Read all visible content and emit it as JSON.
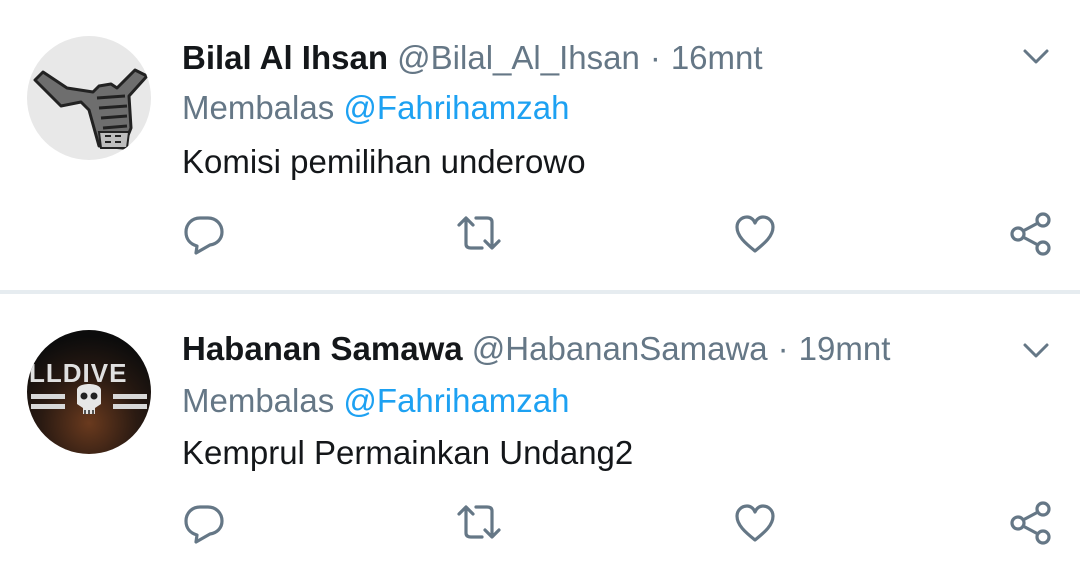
{
  "tweets": [
    {
      "display_name": "Bilal Al Ihsan",
      "handle": "@Bilal_Al_Ihsan",
      "separator": "·",
      "time": "16mnt",
      "reply_prefix": "Membalas",
      "reply_to": "@Fahrihamzah",
      "text": "Komisi pemilihan underowo",
      "avatar_icon": "hand-gesture-avatar"
    },
    {
      "display_name": "Habanan Samawa",
      "handle": "@HabananSamawa",
      "separator": "·",
      "time": "19mnt",
      "reply_prefix": "Membalas",
      "reply_to": "@Fahrihamzah",
      "text": "Kemprul Permainkan Undang2",
      "avatar_text": "LLDIVE",
      "avatar_icon": "helldivers-skull-avatar"
    }
  ],
  "colors": {
    "name": "#14171a",
    "muted": "#657786",
    "link": "#1da1f2",
    "icon": "#657786",
    "divider": "#e6ecf0"
  },
  "actions": [
    "reply-icon",
    "retweet-icon",
    "like-icon",
    "share-icon"
  ]
}
